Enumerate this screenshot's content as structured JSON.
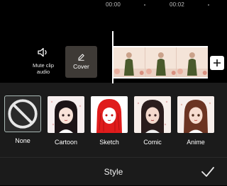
{
  "ruler": {
    "tc1": "00:00",
    "tc2": "00:02"
  },
  "track": {
    "mute_label": "Mute clip audio",
    "cover_label": "Cover"
  },
  "styles": [
    {
      "label": "None",
      "icon": "no-symbol-icon"
    },
    {
      "label": "Cartoon"
    },
    {
      "label": "Sketch"
    },
    {
      "label": "Comic"
    },
    {
      "label": "Anime"
    }
  ],
  "panel": {
    "title": "Style",
    "selected": "None"
  },
  "colors": {
    "background": "#000000",
    "panel": "#1b1b1b",
    "selected_border": "#a9b9b5"
  }
}
